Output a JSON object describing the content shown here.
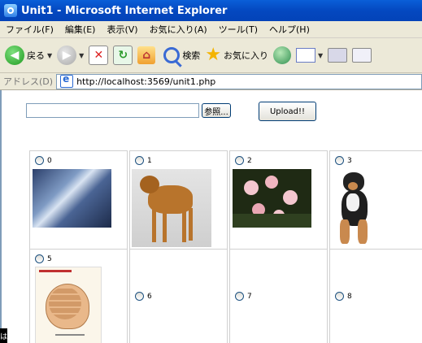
{
  "window": {
    "title": "Unit1 - Microsoft Internet Explorer"
  },
  "menu": [
    "ファイル(F)",
    "編集(E)",
    "表示(V)",
    "お気に入り(A)",
    "ツール(T)",
    "ヘルプ(H)"
  ],
  "toolbar": {
    "back_label": "戻る",
    "search_label": "検索",
    "favorites_label": "お気に入り"
  },
  "address": {
    "label": "アドレス(D)",
    "url": "http://localhost:3569/unit1.php"
  },
  "form": {
    "browse_label": "参照...",
    "upload_label": "Upload!!"
  },
  "grid": {
    "items": [
      {
        "label": "0",
        "image": "cd-cover-photo"
      },
      {
        "label": "1",
        "image": "dog-photo"
      },
      {
        "label": "2",
        "image": "flowers-photo"
      },
      {
        "label": "3",
        "image": "dog-sitting-photo"
      },
      {
        "label": "5",
        "image": "brain-diagram-photo"
      },
      {
        "label": "6",
        "image": ""
      },
      {
        "label": "7",
        "image": ""
      },
      {
        "label": "8",
        "image": ""
      }
    ]
  },
  "taskbar": {
    "fragment": "は"
  },
  "colors": {
    "titlebar": "#0448c0",
    "chrome": "#ece9d8",
    "border": "#7f9db9"
  }
}
